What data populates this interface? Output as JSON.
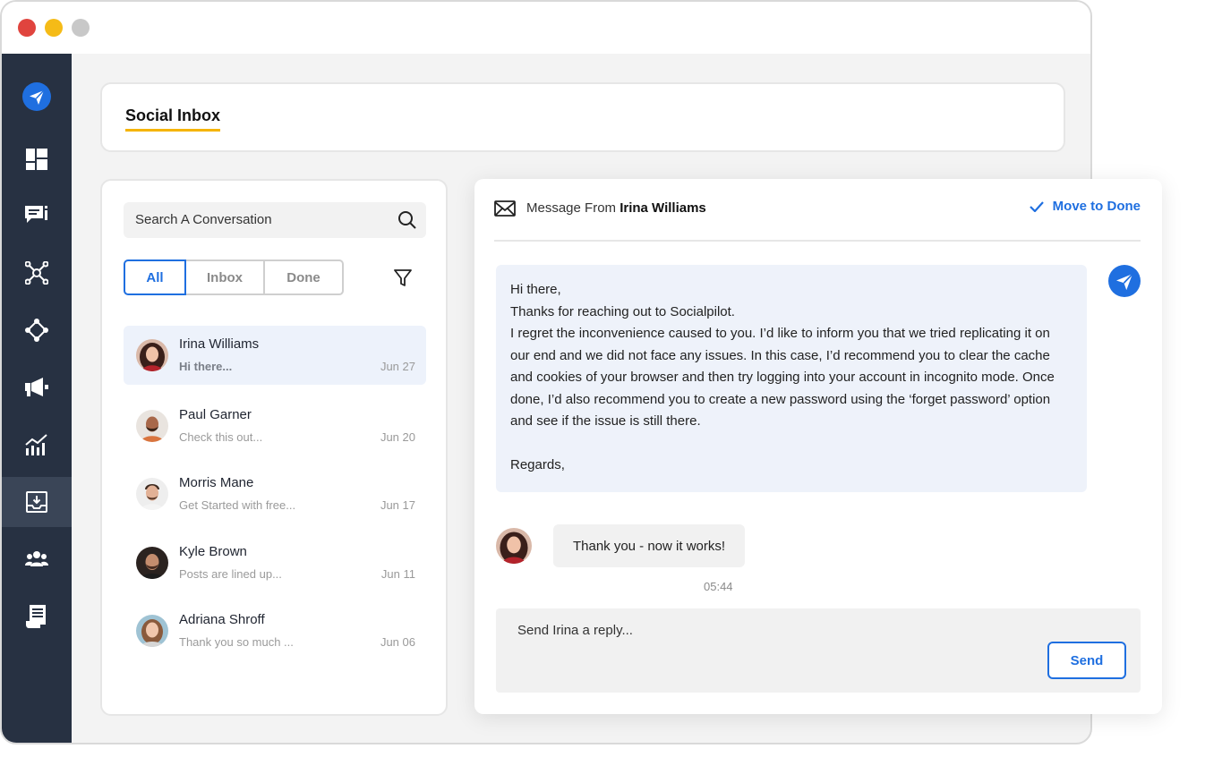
{
  "window": {
    "controls": [
      "close",
      "minimize",
      "maximize"
    ]
  },
  "sidebar": {
    "items": [
      {
        "icon": "socialpilot-logo-icon"
      },
      {
        "icon": "dashboard-icon"
      },
      {
        "icon": "posts-icon"
      },
      {
        "icon": "network-icon"
      },
      {
        "icon": "connections-icon"
      },
      {
        "icon": "megaphone-icon"
      },
      {
        "icon": "analytics-icon"
      },
      {
        "icon": "inbox-icon",
        "active": true
      },
      {
        "icon": "team-icon"
      },
      {
        "icon": "reports-icon"
      }
    ]
  },
  "header": {
    "title": "Social Inbox"
  },
  "list": {
    "search_placeholder": "Search A Conversation",
    "tabs": [
      "All",
      "Inbox",
      "Done"
    ],
    "active_tab": "All",
    "conversations": [
      {
        "name": "Irina Williams",
        "preview": "Hi there...",
        "date": "Jun 27",
        "selected": true
      },
      {
        "name": "Paul Garner",
        "preview": "Check this out...",
        "date": "Jun 20"
      },
      {
        "name": "Morris Mane",
        "preview": "Get Started with free...",
        "date": "Jun 17"
      },
      {
        "name": "Kyle Brown",
        "preview": "Posts are lined up...",
        "date": "Jun 11"
      },
      {
        "name": "Adriana Shroff",
        "preview": "Thank you so much ...",
        "date": "Jun 06"
      }
    ]
  },
  "message": {
    "header_prefix": "Message From",
    "sender": "Irina Williams",
    "done_label": "Move to Done",
    "sent_lines": [
      "Hi there,",
      "Thanks for reaching out to Socialpilot.",
      "I regret the inconvenience caused to you. I’d like to inform you that we tried replicating it on our end and we did not face any issues. In this case, I’d recommend you to clear the cache and cookies of your browser and then try logging into your account in incognito mode. Once done, I’d also recommend you to create a new password using the ‘forget password’ option and see if the issue is still there.",
      "",
      "Regards,"
    ],
    "received": "Thank you - now it works!",
    "time": "05:44",
    "reply_placeholder": "Send Irina a reply...",
    "send_label": "Send"
  },
  "colors": {
    "accent": "#1f6fe0",
    "sidebar": "#273142",
    "underline": "#f5b400"
  }
}
